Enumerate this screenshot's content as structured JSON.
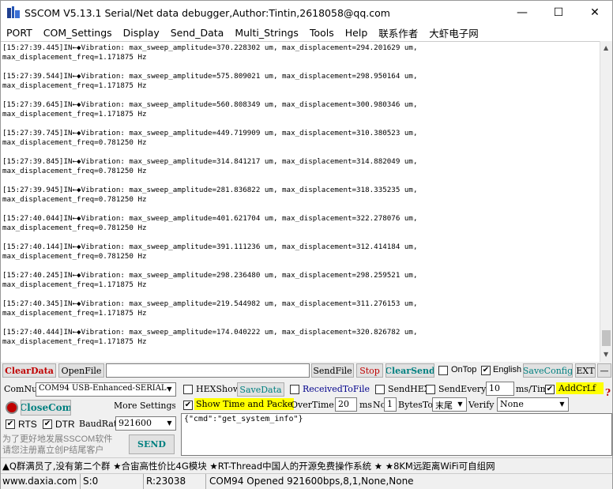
{
  "window": {
    "title": "SSCOM V5.13.1 Serial/Net data debugger,Author:Tintin,2618058@qq.com",
    "minimize_glyph": "—",
    "maximize_glyph": "☐",
    "close_glyph": "✕"
  },
  "menu": [
    "PORT",
    "COM_Settings",
    "Display",
    "Send_Data",
    "Multi_Strings",
    "Tools",
    "Help",
    "联系作者",
    "大虾电子网"
  ],
  "log": [
    {
      "line1": "[15:27:39.445]IN←◆Vibration: max_sweep_amplitude=370.228302 um, max_displacement=294.201629 um,",
      "line2": "max_displacement_freq=1.171875 Hz"
    },
    {
      "line1": "[15:27:39.544]IN←◆Vibration: max_sweep_amplitude=575.809021 um, max_displacement=298.950164 um,",
      "line2": "max_displacement_freq=1.171875 Hz"
    },
    {
      "line1": "[15:27:39.645]IN←◆Vibration: max_sweep_amplitude=560.808349 um, max_displacement=300.980346 um,",
      "line2": "max_displacement_freq=1.171875 Hz"
    },
    {
      "line1": "[15:27:39.745]IN←◆Vibration: max_sweep_amplitude=449.719909 um, max_displacement=310.380523 um,",
      "line2": "max_displacement_freq=0.781250 Hz"
    },
    {
      "line1": "[15:27:39.845]IN←◆Vibration: max_sweep_amplitude=314.841217 um, max_displacement=314.882049 um,",
      "line2": "max_displacement_freq=0.781250 Hz"
    },
    {
      "line1": "[15:27:39.945]IN←◆Vibration: max_sweep_amplitude=281.836822 um, max_displacement=318.335235 um,",
      "line2": "max_displacement_freq=0.781250 Hz"
    },
    {
      "line1": "[15:27:40.044]IN←◆Vibration: max_sweep_amplitude=401.621704 um, max_displacement=322.278076 um,",
      "line2": "max_displacement_freq=0.781250 Hz"
    },
    {
      "line1": "[15:27:40.144]IN←◆Vibration: max_sweep_amplitude=391.111236 um, max_displacement=312.414184 um,",
      "line2": "max_displacement_freq=0.781250 Hz"
    },
    {
      "line1": "[15:27:40.245]IN←◆Vibration: max_sweep_amplitude=298.236480 um, max_displacement=298.259521 um,",
      "line2": "max_displacement_freq=1.171875 Hz"
    },
    {
      "line1": "[15:27:40.345]IN←◆Vibration: max_sweep_amplitude=219.544982 um, max_displacement=311.276153 um,",
      "line2": "max_displacement_freq=1.171875 Hz"
    },
    {
      "line1": "[15:27:40.444]IN←◆Vibration: max_sweep_amplitude=174.040222 um, max_displacement=320.826782 um,",
      "line2": "max_displacement_freq=1.171875 Hz"
    }
  ],
  "toolbar": {
    "clear_data": "ClearData",
    "open_file": "OpenFile",
    "file_path": "",
    "send_file": "SendFile",
    "stop": "Stop",
    "clear_send": "ClearSend",
    "on_top": "OnTop",
    "english": "English",
    "save_config": "SaveConfig",
    "ext": "EXT",
    "minus": "—"
  },
  "port": {
    "com_num_label": "ComNum",
    "com_num_value": "COM94 USB-Enhanced-SERIAL-",
    "close_com": "CloseCom",
    "more_settings": "More Settings",
    "rts": "RTS",
    "dtr": "DTR",
    "baud_label": "BaudRat",
    "baud_value": "921600"
  },
  "options": {
    "hex_show": "HEXShow",
    "save_data": "SaveData",
    "received_to_file": "ReceivedToFile",
    "send_hex": "SendHEX",
    "send_every": "SendEvery:",
    "send_every_value": "10",
    "ms_tim": "ms/Tim",
    "add_crlf": "AddCrLf",
    "show_time": "Show Time and Packe",
    "over_time": "OverTime:",
    "over_time_value": "20",
    "ms": "ms",
    "no": "No",
    "no_value": "1",
    "bytes_to": "BytesTo",
    "bytes_to_value": "末尾",
    "verify": "Verify",
    "verify_value": "None",
    "help": "?"
  },
  "send": {
    "text": "{\"cmd\":\"get_system_info\"}",
    "button": "SEND",
    "promo_line1": "为了更好地发展SSCOM软件",
    "promo_line2": "请您注册嘉立创P结尾客户"
  },
  "ticker": "▲Q群满员了,没有第二个群 ★合宙高性价比4G模块 ★RT-Thread中国人的开源免费操作系统 ★ ★8KM远距离WiFi可自组网",
  "status": {
    "website": "www.daxia.com",
    "sent": "S:0",
    "received": "R:23038",
    "port_state": "COM94 Opened  921600bps,8,1,None,None"
  },
  "colors": {
    "red_text": "#c00000",
    "teal_text": "#008080",
    "highlight": "#ffff00"
  }
}
